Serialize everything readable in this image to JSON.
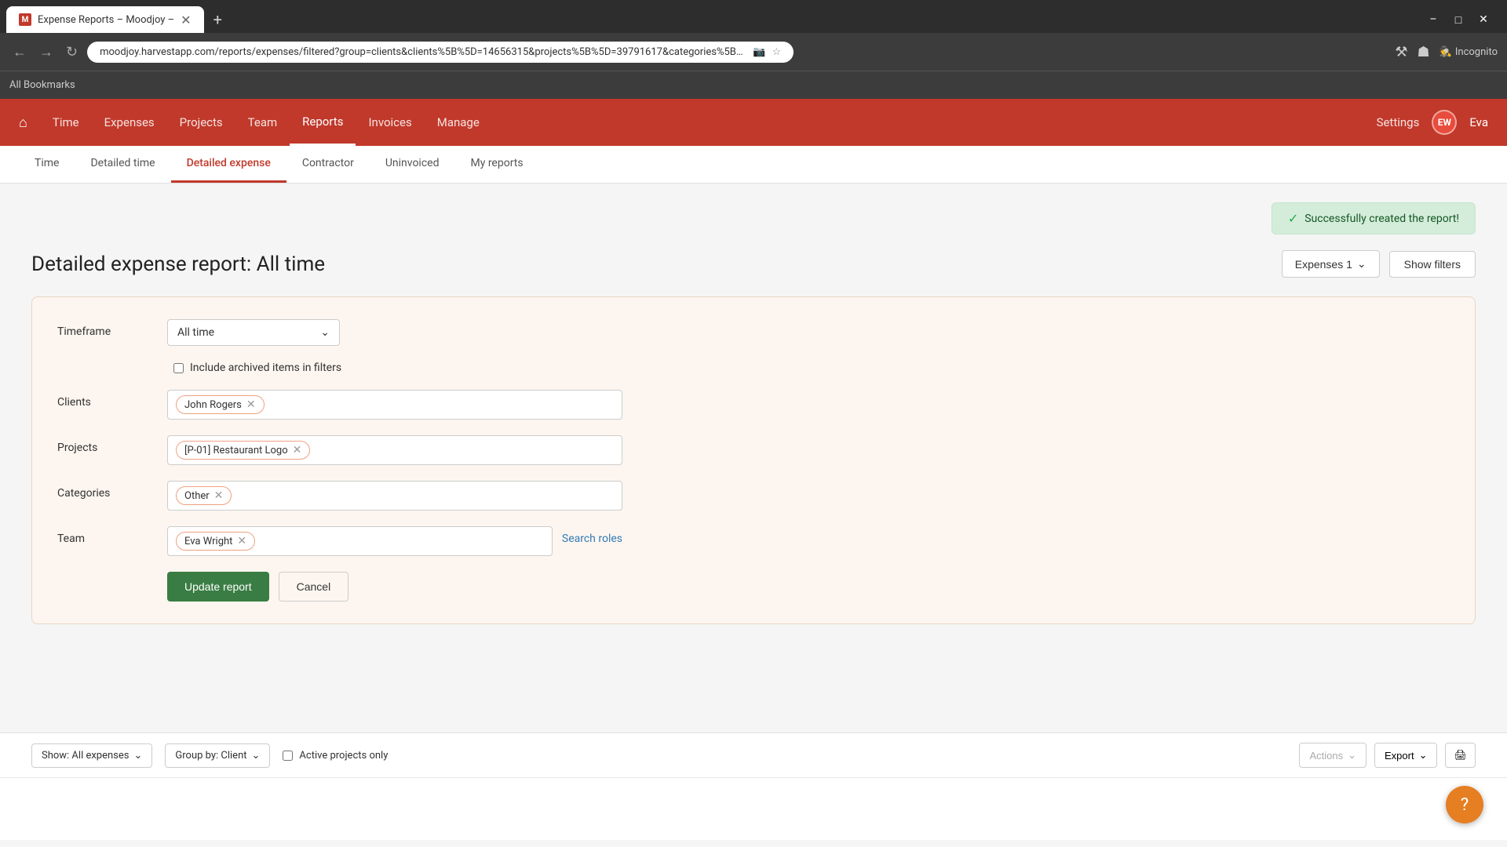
{
  "browser": {
    "tab_title": "Expense Reports – Moodjoy –",
    "url": "moodjoy.harvestapp.com/reports/expenses/filtered?group=clients&clients%5B%5D=14656315&projects%5B%5D=39791617&categories%5B%5D=101...",
    "favicon_text": "M",
    "new_tab": "+",
    "incognito_label": "Incognito",
    "bookmarks_label": "All Bookmarks"
  },
  "nav": {
    "home_icon": "⌂",
    "links": [
      {
        "label": "Time",
        "active": false
      },
      {
        "label": "Expenses",
        "active": false
      },
      {
        "label": "Projects",
        "active": false
      },
      {
        "label": "Team",
        "active": false
      },
      {
        "label": "Reports",
        "active": true
      },
      {
        "label": "Invoices",
        "active": false
      },
      {
        "label": "Manage",
        "active": false
      }
    ],
    "settings_label": "Settings",
    "user_initials": "EW",
    "user_name": "Eva"
  },
  "sub_nav": {
    "links": [
      {
        "label": "Time",
        "active": false
      },
      {
        "label": "Detailed time",
        "active": false
      },
      {
        "label": "Detailed expense",
        "active": true
      },
      {
        "label": "Contractor",
        "active": false
      },
      {
        "label": "Uninvoiced",
        "active": false
      },
      {
        "label": "My reports",
        "active": false
      }
    ]
  },
  "toast": {
    "message": "Successfully created the report!",
    "check": "✓"
  },
  "page": {
    "title": "Detailed expense report: All time",
    "expenses_btn": "Expenses 1",
    "show_filters_btn": "Show filters"
  },
  "filters": {
    "timeframe_label": "Timeframe",
    "timeframe_value": "All time",
    "include_archived_label": "Include archived items in filters",
    "clients_label": "Clients",
    "clients_tags": [
      {
        "label": "John Rogers",
        "id": "john-rogers"
      }
    ],
    "projects_label": "Projects",
    "projects_tags": [
      {
        "label": "[P-01] Restaurant Logo",
        "id": "p01-restaurant-logo"
      }
    ],
    "categories_label": "Categories",
    "categories_tags": [
      {
        "label": "Other",
        "id": "other"
      }
    ],
    "team_label": "Team",
    "team_tags": [
      {
        "label": "Eva Wright",
        "id": "eva-wright"
      }
    ],
    "search_roles_label": "Search roles",
    "update_btn": "Update report",
    "cancel_btn": "Cancel"
  },
  "toolbar": {
    "show_label": "Show: All expenses",
    "group_label": "Group by: Client",
    "active_projects_label": "Active projects only",
    "actions_label": "Actions",
    "export_label": "Export",
    "print_icon": "🖨"
  },
  "help_btn": "?"
}
